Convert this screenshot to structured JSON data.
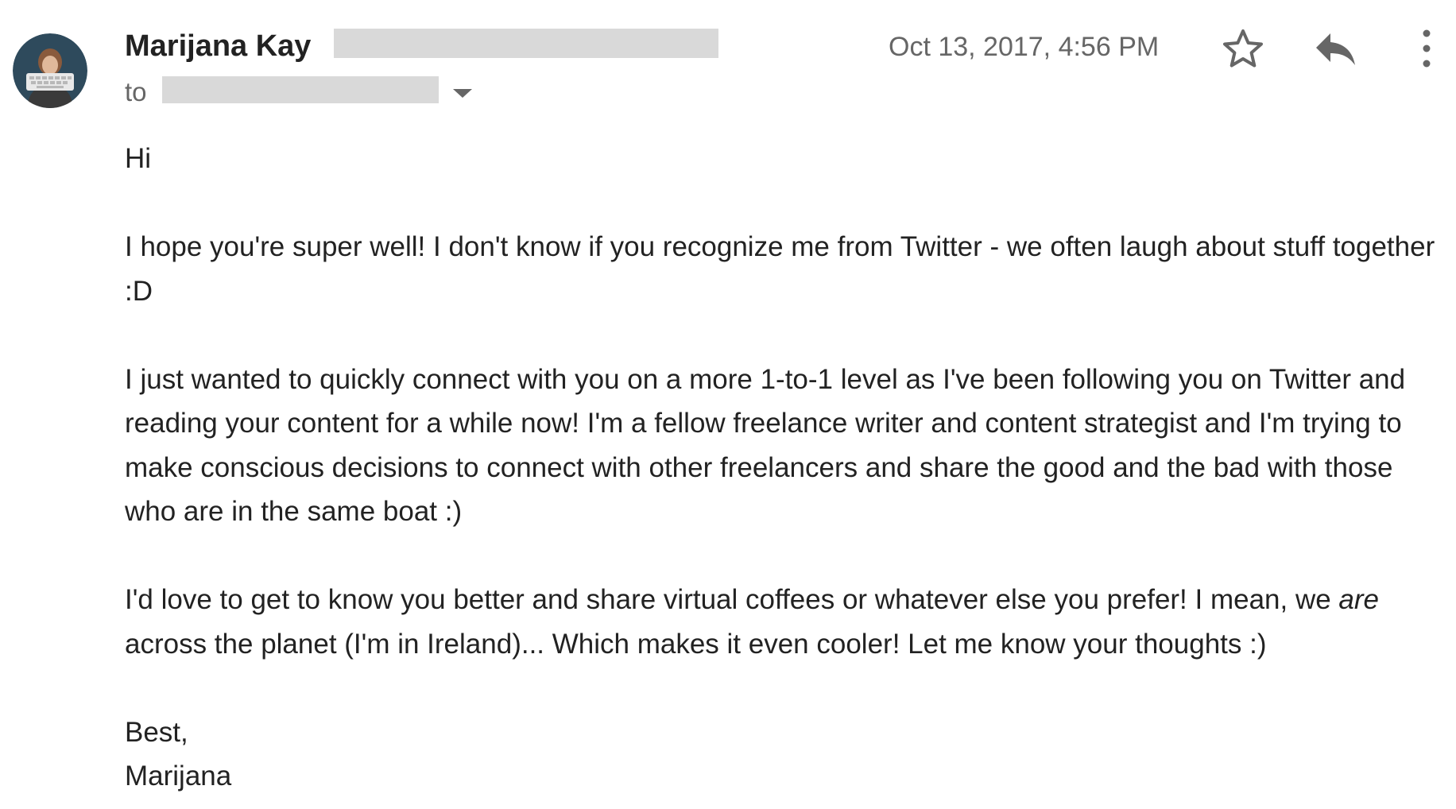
{
  "email": {
    "sender": {
      "name": "Marijana Kay"
    },
    "recipient_label": "to",
    "timestamp": "Oct 13, 2017, 4:56 PM",
    "actions": {
      "star_icon": "star-outline-icon",
      "reply_icon": "reply-arrow-icon",
      "more_icon": "vertical-dots-icon"
    },
    "body": {
      "greeting": "Hi",
      "paragraph1": "I hope you're super well! I don't know if you recognize me from Twitter - we often laugh about stuff together :D",
      "paragraph2": "I just wanted to quickly connect with you on a more 1-to-1 level as I've been following you on Twitter and reading your content for a while now! I'm a fellow freelance writer and content strategist and I'm trying to make conscious decisions to connect with other freelancers and share the good and the bad with those who are in the same boat :)",
      "paragraph3_part1": "I'd love to get to know you better and share virtual coffees or whatever else you prefer! I mean, we ",
      "paragraph3_italic": "are",
      "paragraph3_part2": " across the planet (I'm in Ireland)... Which makes it even cooler! Let me know your thoughts :)",
      "signoff": "Best,",
      "signature": "Marijana"
    }
  },
  "colors": {
    "text": "#222222",
    "secondary_text": "#666666",
    "redaction": "#d9d9d9",
    "icon": "#666666",
    "avatar_background": "#2e4a5c"
  }
}
